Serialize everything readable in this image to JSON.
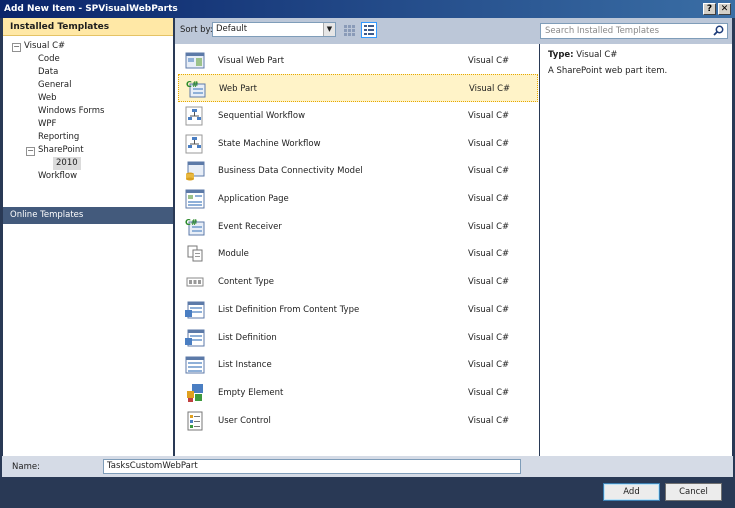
{
  "window": {
    "title": "Add New Item - SPVisualWebParts",
    "help_glyph": "?",
    "close_glyph": "✕"
  },
  "left": {
    "header": "Installed Templates",
    "tree": [
      {
        "label": "Visual C#",
        "expander": "−"
      },
      {
        "label": "Code"
      },
      {
        "label": "Data"
      },
      {
        "label": "General"
      },
      {
        "label": "Web"
      },
      {
        "label": "Windows Forms"
      },
      {
        "label": "WPF"
      },
      {
        "label": "Reporting"
      },
      {
        "label": "SharePoint",
        "expander": "−"
      },
      {
        "label": "2010"
      },
      {
        "label": "Workflow"
      }
    ],
    "online": "Online Templates"
  },
  "toolbar": {
    "sort_label": "Sort by:",
    "sort_value": "Default",
    "search_placeholder": "Search Installed Templates"
  },
  "items": [
    {
      "name": "Visual Web Part",
      "type": "Visual C#",
      "icon": "visual-web-part-icon"
    },
    {
      "name": "Web Part",
      "type": "Visual C#",
      "icon": "web-part-icon"
    },
    {
      "name": "Sequential Workflow",
      "type": "Visual C#",
      "icon": "sequential-workflow-icon"
    },
    {
      "name": "State Machine Workflow",
      "type": "Visual C#",
      "icon": "state-machine-workflow-icon"
    },
    {
      "name": "Business Data Connectivity Model",
      "type": "Visual C#",
      "icon": "bdc-model-icon"
    },
    {
      "name": "Application Page",
      "type": "Visual C#",
      "icon": "application-page-icon"
    },
    {
      "name": "Event Receiver",
      "type": "Visual C#",
      "icon": "event-receiver-icon"
    },
    {
      "name": "Module",
      "type": "Visual C#",
      "icon": "module-icon"
    },
    {
      "name": "Content Type",
      "type": "Visual C#",
      "icon": "content-type-icon"
    },
    {
      "name": "List Definition From Content Type",
      "type": "Visual C#",
      "icon": "list-definition-from-content-type-icon"
    },
    {
      "name": "List Definition",
      "type": "Visual C#",
      "icon": "list-definition-icon"
    },
    {
      "name": "List Instance",
      "type": "Visual C#",
      "icon": "list-instance-icon"
    },
    {
      "name": "Empty Element",
      "type": "Visual C#",
      "icon": "empty-element-icon"
    },
    {
      "name": "User Control",
      "type": "Visual C#",
      "icon": "user-control-icon"
    }
  ],
  "details": {
    "type_label": "Type:",
    "type_value": "Visual C#",
    "description": "A SharePoint web part item."
  },
  "name_field": {
    "label": "Name:",
    "value": "TasksCustomWebPart"
  },
  "buttons": {
    "add": "Add",
    "cancel": "Cancel"
  },
  "colors": {
    "frame": "#293955",
    "header": "#ffe8a6",
    "selection": "#fff3c8",
    "online_bg": "#435a7c"
  }
}
